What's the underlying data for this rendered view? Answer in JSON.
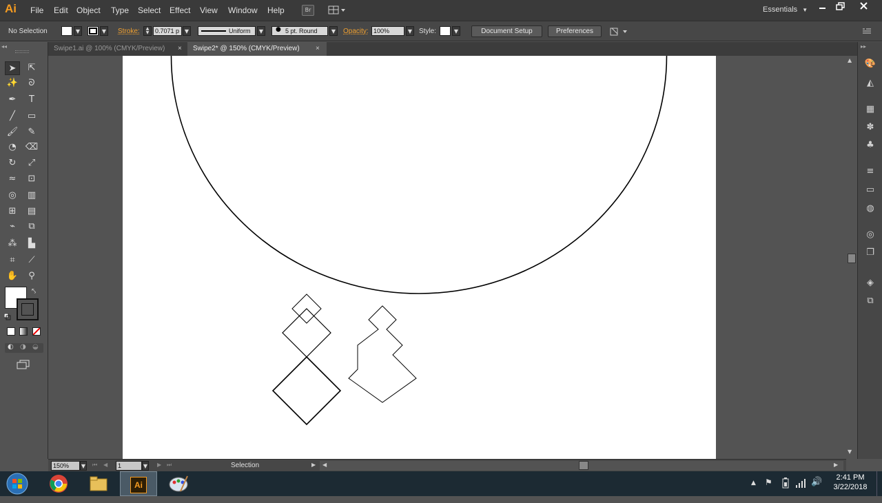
{
  "app": {
    "logo": "Ai",
    "workspace": "Essentials"
  },
  "menu": [
    "File",
    "Edit",
    "Object",
    "Type",
    "Select",
    "Effect",
    "View",
    "Window",
    "Help"
  ],
  "menu_extras": {
    "bridge_label": "Br"
  },
  "control_bar": {
    "selection_status": "No Selection",
    "stroke_label": "Stroke:",
    "stroke_weight": "0.7071 p",
    "stroke_profile": "Uniform",
    "brush": "5 pt. Round",
    "opacity_label": "Opacity:",
    "opacity_value": "100%",
    "style_label": "Style:",
    "document_setup": "Document Setup",
    "preferences": "Preferences"
  },
  "tabs": [
    {
      "label": "Swipe1.ai @ 100% (CMYK/Preview)",
      "active": false
    },
    {
      "label": "Swipe2* @ 150% (CMYK/Preview)",
      "active": true
    }
  ],
  "status_bar": {
    "zoom": "150%",
    "artboard_number": "1",
    "current_tool": "Selection"
  },
  "taskbar": {
    "time": "2:41 PM",
    "date": "3/22/2018",
    "apps": [
      "chrome",
      "file-explorer",
      "illustrator",
      "paint"
    ],
    "illustrator_label": "Ai"
  },
  "colors": {
    "brand": "#f49b21",
    "menubar": "#3a3a3a",
    "controlbar": "#474747",
    "pasteboard": "#535353",
    "artboard": "#ffffff",
    "taskbar": "#1c2a33"
  },
  "icons": {
    "tools": [
      "selection-tool-icon",
      "direct-selection-tool-icon",
      "magic-wand-tool-icon",
      "lasso-tool-icon",
      "pen-tool-icon",
      "type-tool-icon",
      "line-segment-tool-icon",
      "rectangle-tool-icon",
      "paintbrush-tool-icon",
      "pencil-tool-icon",
      "blob-brush-tool-icon",
      "eraser-tool-icon",
      "rotate-tool-icon",
      "scale-tool-icon",
      "warp-tool-icon",
      "free-transform-tool-icon",
      "shape-builder-tool-icon",
      "perspective-grid-tool-icon",
      "mesh-tool-icon",
      "gradient-tool-icon",
      "eyedropper-tool-icon",
      "blend-tool-icon",
      "symbol-sprayer-tool-icon",
      "column-graph-tool-icon",
      "artboard-tool-icon",
      "slice-tool-icon",
      "hand-tool-icon",
      "zoom-tool-icon"
    ],
    "panels": [
      "color-panel-icon",
      "color-guide-panel-icon",
      "swatches-panel-icon",
      "brushes-panel-icon",
      "symbols-panel-icon",
      "stroke-panel-icon",
      "gradient-panel-icon",
      "transparency-panel-icon",
      "appearance-panel-icon",
      "graphic-styles-panel-icon",
      "layers-panel-icon",
      "artboards-panel-icon"
    ]
  }
}
